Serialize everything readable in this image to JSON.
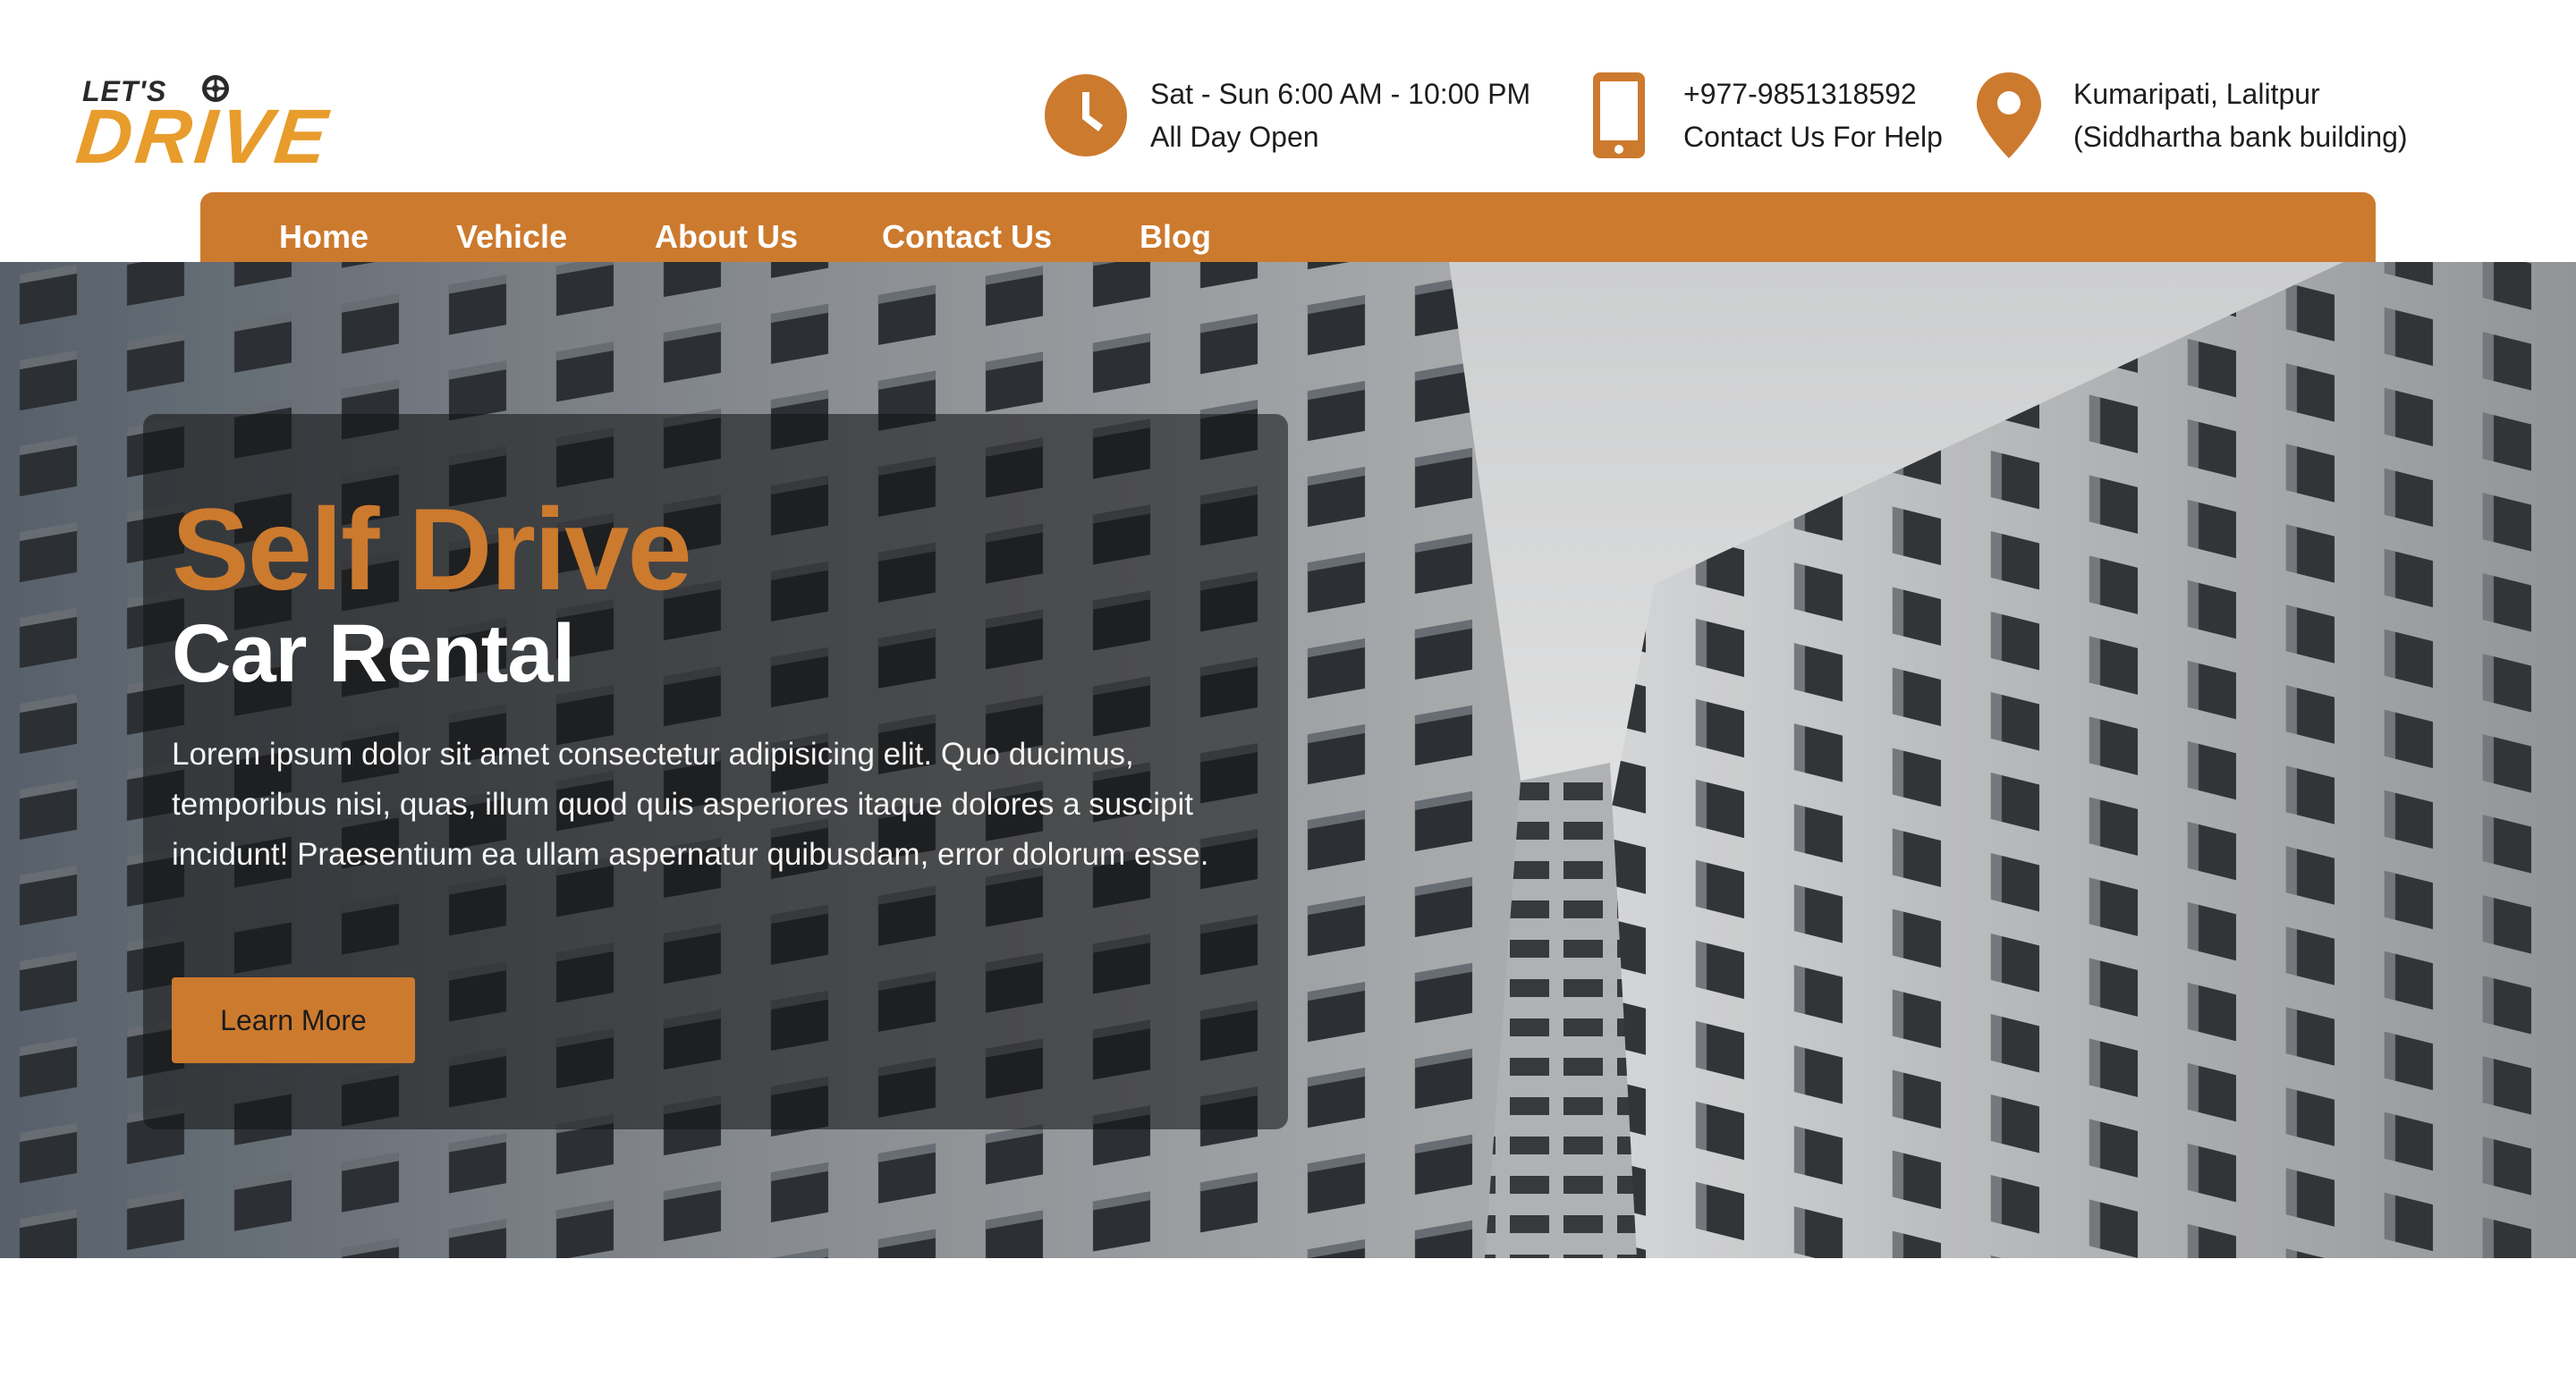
{
  "brand": {
    "logo_top": "LET'S",
    "logo_main": "DRIVE",
    "accent_color": "#cc7a2e",
    "logo_color": "#e89c2c"
  },
  "header_info": {
    "hours": {
      "icon": "clock-icon",
      "line1": "Sat - Sun 6:00 AM - 10:00 PM",
      "line2": "All Day Open"
    },
    "phone": {
      "icon": "phone-icon",
      "line1": "+977-9851318592",
      "line2": "Contact Us For Help"
    },
    "location": {
      "icon": "map-pin-icon",
      "line1": "Kumaripati, Lalitpur",
      "line2": "(Siddhartha bank building)"
    }
  },
  "nav": {
    "items": [
      "Home",
      "Vehicle",
      "About Us",
      "Contact Us",
      "Blog"
    ]
  },
  "hero": {
    "background": "building-photo",
    "title": "Self Drive",
    "subtitle": "Car Rental",
    "text": "Lorem ipsum dolor sit amet consectetur adipisicing elit. Quo ducimus, temporibus nisi, quas, illum quod quis asperiores itaque dolores a suscipit incidunt! Praesentium ea ullam aspernatur quibusdam, error dolorum esse.",
    "button_label": "Learn More"
  }
}
